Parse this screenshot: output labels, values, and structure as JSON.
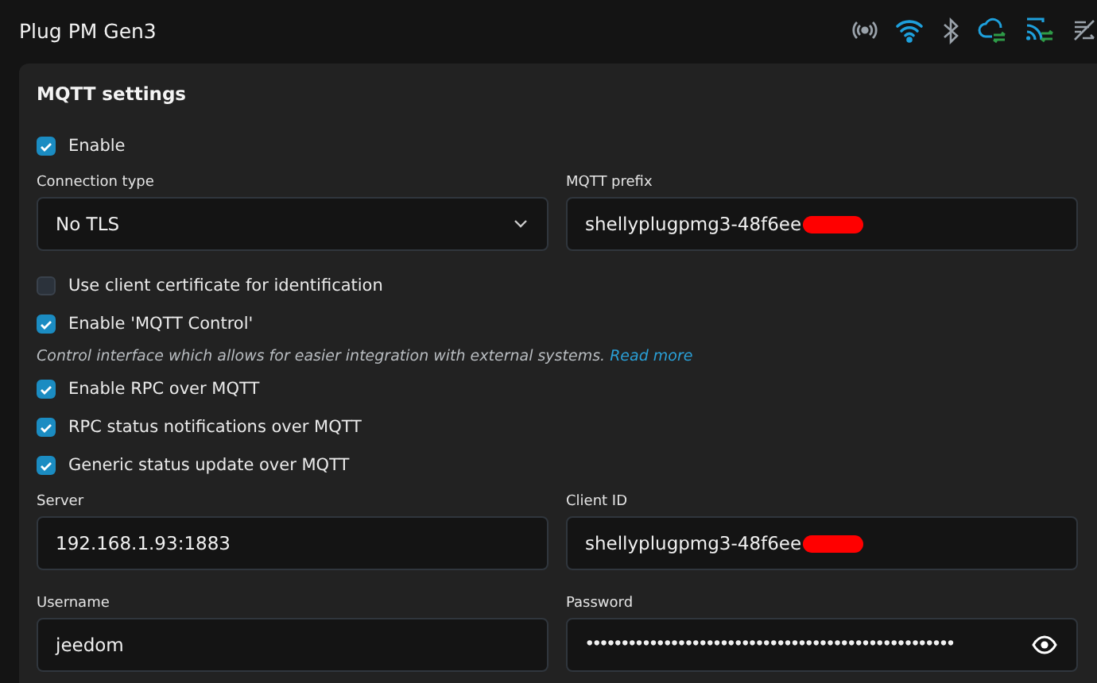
{
  "device": {
    "title": "Plug PM Gen3"
  },
  "section": {
    "title": "MQTT settings"
  },
  "items": [
    {
      "kind": "checkbox",
      "label": "Enable",
      "checked": true
    },
    {
      "kind": "fields",
      "fields": [
        {
          "label": "Connection type",
          "value": "No TLS",
          "kind": "select"
        },
        {
          "label": "MQTT prefix",
          "value": "shellyplugpmg3-48f6ee",
          "kind": "text",
          "redacted": true
        }
      ]
    },
    {
      "kind": "checkbox",
      "label": "Use client certificate for identification",
      "checked": false
    },
    {
      "kind": "checkbox",
      "label": "Enable 'MQTT Control'",
      "checked": true
    },
    {
      "kind": "note",
      "text": "Control interface which allows for easier integration with external systems.",
      "link": "Read more"
    },
    {
      "kind": "checkbox",
      "label": "Enable RPC over MQTT",
      "checked": true
    },
    {
      "kind": "checkbox",
      "label": "RPC status notifications over MQTT",
      "checked": true
    },
    {
      "kind": "checkbox",
      "label": "Generic status update over MQTT",
      "checked": true
    },
    {
      "kind": "fields",
      "fields": [
        {
          "label": "Server",
          "value": "192.168.1.93:1883",
          "kind": "text"
        },
        {
          "label": "Client ID",
          "value": "shellyplugpmg3-48f6ee",
          "kind": "text",
          "redacted": true
        }
      ]
    },
    {
      "kind": "fields",
      "fields": [
        {
          "label": "Username",
          "value": "jeedom",
          "kind": "text"
        },
        {
          "label": "Password",
          "value": "••••••••••••••••••••••••••••••••••••••••••••••••••••",
          "kind": "password"
        }
      ]
    }
  ]
}
